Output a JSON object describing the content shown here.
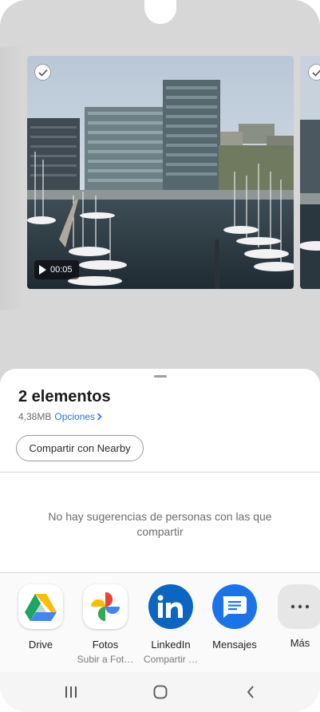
{
  "preview": {
    "video_duration": "00:05"
  },
  "sheet": {
    "title": "2 elementos",
    "size": "4,38MB",
    "options_label": "Opciones",
    "nearby_button": "Compartir con Nearby",
    "suggestions_empty": "No hay sugerencias de personas con las que compartir"
  },
  "apps": [
    {
      "name": "Drive",
      "sub": "",
      "icon": "google-drive-icon"
    },
    {
      "name": "Fotos",
      "sub": "Subir a Fot…",
      "icon": "google-photos-icon"
    },
    {
      "name": "LinkedIn",
      "sub": "Compartir …",
      "icon": "linkedin-icon"
    },
    {
      "name": "Mensajes",
      "sub": "",
      "icon": "messages-icon"
    },
    {
      "name": "Más",
      "sub": "",
      "icon": "more-icon"
    }
  ],
  "colors": {
    "accent": "#2277d9",
    "linkedin": "#0a66c2",
    "messages": "#1a73e8"
  }
}
